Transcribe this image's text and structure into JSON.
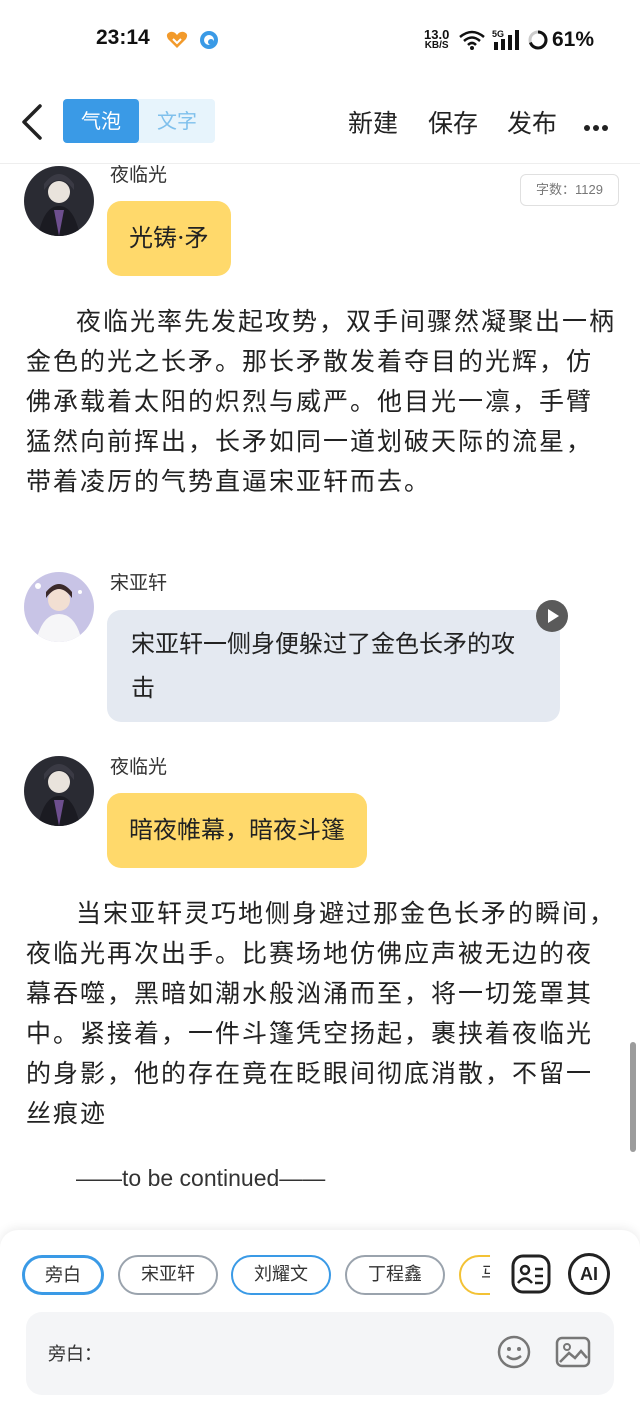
{
  "status_bar": {
    "time": "23:14",
    "net_speed_value": "13.0",
    "net_speed_unit": "KB/S",
    "battery": "61%"
  },
  "header": {
    "toggle": [
      "气泡",
      "文字"
    ],
    "new_label": "新建",
    "save_label": "保存",
    "publish_label": "发布"
  },
  "word_count": "字数：1129",
  "messages": [
    {
      "speaker": "夜临光",
      "text": "光铸·矛"
    },
    {
      "speaker": "宋亚轩",
      "text": "宋亚轩一侧身便躲过了金色长矛的攻击"
    },
    {
      "speaker": "夜临光",
      "text": "暗夜帷幕，暗夜斗篷"
    }
  ],
  "narration": [
    "夜临光率先发起攻势，双手间骤然凝聚出一柄金色的光之长矛。那长矛散发着夺目的光辉，仿佛承载着太阳的炽烈与威严。他目光一凛，手臂猛然向前挥出，长矛如同一道划破天际的流星，带着凌厉的气势直逼宋亚轩而去。",
    "当宋亚轩灵巧地侧身避过那金色长矛的瞬间，夜临光再次出手。比赛场地仿佛应声被无边的夜幕吞噬，黑暗如潮水般汹涌而至，将一切笼罩其中。紧接着，一件斗篷凭空扬起，裹挟着夜临光的身影，他的存在竟在眨眼间彻底消散，不留一丝痕迹"
  ],
  "continued": "——to be continued——",
  "composer": {
    "characters": [
      "旁白",
      "宋亚轩",
      "刘耀文",
      "丁程鑫",
      "马"
    ],
    "input_label": "旁白：",
    "ai_label": "AI"
  },
  "colors": {
    "accent_blue": "#3a9ae6",
    "bubble_yellow": "#ffd96b",
    "bubble_gray": "#e4e9f1"
  }
}
